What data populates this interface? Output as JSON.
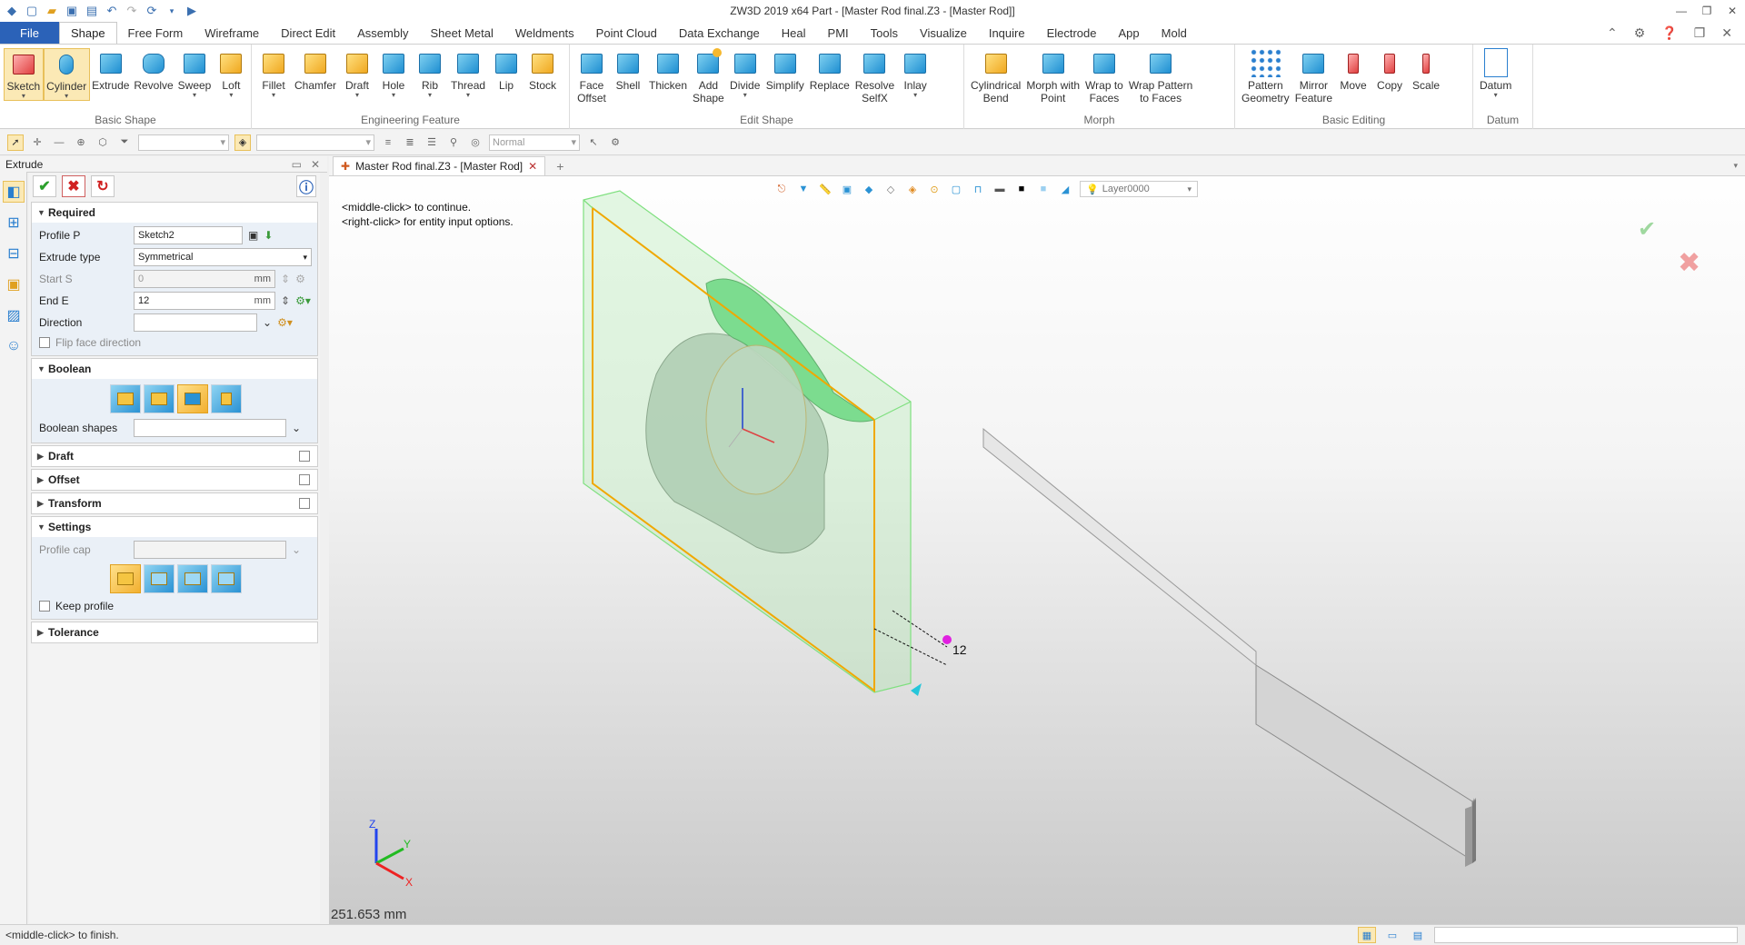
{
  "title": "ZW3D 2019  x64          Part - [Master Rod final.Z3 - [Master Rod]]",
  "menus": [
    {
      "label": "File"
    },
    {
      "label": "Shape"
    },
    {
      "label": "Free Form"
    },
    {
      "label": "Wireframe"
    },
    {
      "label": "Direct Edit"
    },
    {
      "label": "Assembly"
    },
    {
      "label": "Sheet Metal"
    },
    {
      "label": "Weldments"
    },
    {
      "label": "Point Cloud"
    },
    {
      "label": "Data Exchange"
    },
    {
      "label": "Heal"
    },
    {
      "label": "PMI"
    },
    {
      "label": "Tools"
    },
    {
      "label": "Visualize"
    },
    {
      "label": "Inquire"
    },
    {
      "label": "Electrode"
    },
    {
      "label": "App"
    },
    {
      "label": "Mold"
    }
  ],
  "ribbon": {
    "basic_shape": {
      "label": "Basic Shape",
      "items": [
        "Sketch",
        "Cylinder",
        "Extrude",
        "Revolve",
        "Sweep",
        "Loft"
      ]
    },
    "engineering": {
      "label": "Engineering Feature",
      "items": [
        "Fillet",
        "Chamfer",
        "Draft",
        "Hole",
        "Rib",
        "Thread",
        "Lip",
        "Stock"
      ]
    },
    "edit_shape": {
      "label": "Edit Shape",
      "items": [
        "Face\nOffset",
        "Shell",
        "Thicken",
        "Add\nShape",
        "Divide",
        "Simplify",
        "Replace",
        "Resolve\nSelfX",
        "Inlay"
      ]
    },
    "morph": {
      "label": "Morph",
      "items": [
        "Cylindrical\nBend",
        "Morph with\nPoint",
        "Wrap to\nFaces",
        "Wrap Pattern\nto Faces"
      ]
    },
    "basic_editing": {
      "label": "Basic Editing",
      "items": [
        "Pattern\nGeometry",
        "Mirror\nFeature",
        "Move",
        "Copy",
        "Scale"
      ]
    },
    "datum": {
      "label": "Datum",
      "items": [
        "Datum"
      ]
    }
  },
  "toolbar2": {
    "render_mode": "Normal"
  },
  "panel": {
    "title": "Extrude",
    "required": {
      "label": "Required",
      "profile_label": "Profile P",
      "profile_value": "Sketch2",
      "type_label": "Extrude type",
      "type_value": "Symmetrical",
      "start_label": "Start S",
      "start_value": "0",
      "start_unit": "mm",
      "end_label": "End E",
      "end_value": "12",
      "end_unit": "mm",
      "direction_label": "Direction",
      "flip_label": "Flip face direction"
    },
    "boolean": {
      "label": "Boolean",
      "shapes_label": "Boolean shapes"
    },
    "draft": {
      "label": "Draft"
    },
    "offset": {
      "label": "Offset"
    },
    "transform": {
      "label": "Transform"
    },
    "settings": {
      "label": "Settings",
      "cap_label": "Profile cap",
      "keep_label": "Keep profile"
    },
    "tolerance": {
      "label": "Tolerance"
    }
  },
  "viewport": {
    "tab_label": "Master Rod final.Z3 - [Master Rod]",
    "layer": "Layer0000",
    "prompt_line1": "<middle-click> to continue.",
    "prompt_line2": "<right-click> for entity input options.",
    "dimension": "12",
    "measure": "251.653 mm",
    "axis_z": "Z",
    "axis_y": "Y",
    "axis_x": "X"
  },
  "status": {
    "text": "<middle-click> to finish."
  },
  "colors": {
    "accent": "#2b62b8",
    "highlight": "#fbe9b5",
    "preview_edge": "#f0a800",
    "preview_face": "#7fe07f"
  }
}
